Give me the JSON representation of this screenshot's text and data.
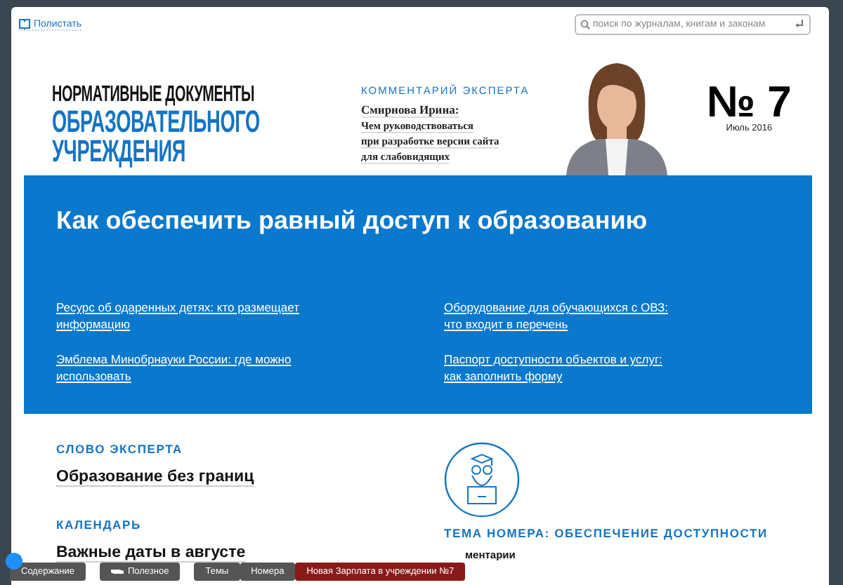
{
  "topbar": {
    "flip_link": "Полистать",
    "search": {
      "placeholder": "поиск по журналам, книгам и законам"
    }
  },
  "masthead": {
    "title_lines": [
      "НОРМАТИВНЫЕ ДОКУМЕНТЫ",
      "ОБРАЗОВАТЕЛЬНОГО",
      "УЧРЕЖДЕНИЯ"
    ],
    "comment": {
      "label": "КОММЕНТАРИЙ ЭКСПЕРТА",
      "author": "Смирнова Ирина:",
      "lines": [
        "Чем руководствоваться",
        "при разработке версии сайта",
        "для слабовидящих"
      ]
    },
    "photo": {
      "kind": "picture"
    },
    "issue": {
      "number": "№ 7",
      "date": "Июль 2016"
    }
  },
  "banner": {
    "title": "Как обеспечить равный доступ к образованию",
    "links": [
      {
        "lines": [
          "Ресурс об одаренных детях: кто размещает",
          "информацию"
        ]
      },
      {
        "lines": [
          "Оборудование для обучающихся с ОВЗ:",
          "что входит в перечень"
        ]
      },
      {
        "lines": [
          "Эмблема Минобрнауки России: где можно",
          "использовать"
        ]
      },
      {
        "lines": [
          "Паспорт доступности объектов и услуг:",
          "как заполнить форму"
        ]
      }
    ]
  },
  "sections": [
    {
      "heading": "СЛОВО ЭКСПЕРТА",
      "article": "Образование без границ"
    },
    {
      "heading": "КАЛЕНДАРЬ",
      "article": "Важные даты в августе"
    }
  ],
  "theme": {
    "heading": "ТЕМА НОМЕРА: ОБЕСПЕЧЕНИЕ ДОСТУПНОСТИ",
    "item": "ментарии"
  },
  "toolbar": [
    {
      "label": "Содержание",
      "kind": "plain"
    },
    {
      "label": "Полезное",
      "kind": "icon"
    },
    {
      "label": "Темы",
      "kind": "plain"
    },
    {
      "label": "Номера",
      "kind": "plain"
    },
    {
      "label": "Новая Зарплата в учреждении №7",
      "kind": "promo"
    }
  ]
}
